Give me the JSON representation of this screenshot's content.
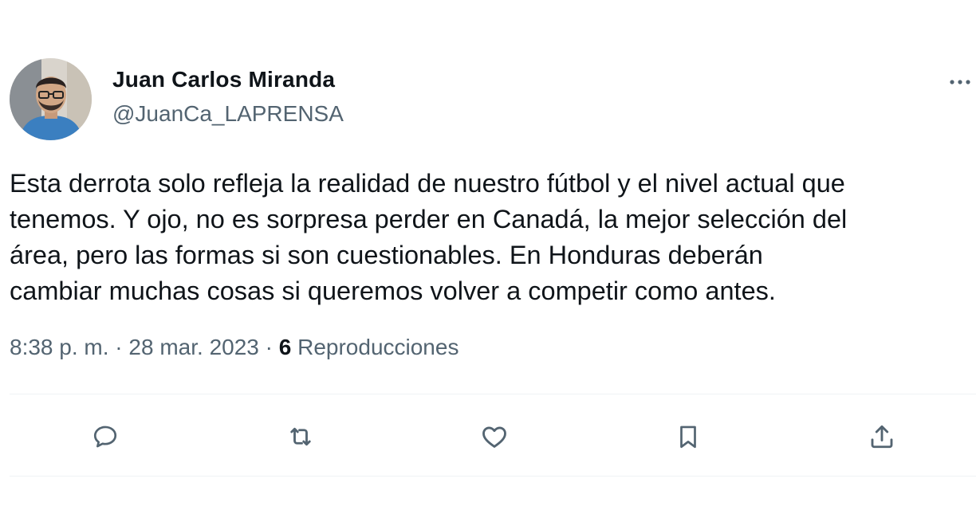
{
  "author": {
    "display_name": "Juan Carlos Miranda",
    "handle": "@JuanCa_LAPRENSA"
  },
  "tweet": {
    "text": "Esta derrota solo refleja la realidad de nuestro fútbol y el nivel actual que\ntenemos. Y ojo, no es sorpresa perder en Canadá, la mejor selección del\nárea, pero las formas si son cuestionables. En Honduras deberán\ncambiar muchas cosas si queremos volver a competir como antes.",
    "time": "8:38 p. m.",
    "separator": "·",
    "date": "28 mar. 2023",
    "views_count": "6",
    "views_label": "Reproducciones"
  },
  "icons": {
    "more": "more-dots-icon",
    "reply": "reply-icon",
    "retweet": "retweet-icon",
    "like": "like-icon",
    "bookmark": "bookmark-icon",
    "share": "share-icon"
  },
  "colors": {
    "text_primary": "#0f1419",
    "text_secondary": "#536471",
    "divider": "#eff3f4"
  }
}
